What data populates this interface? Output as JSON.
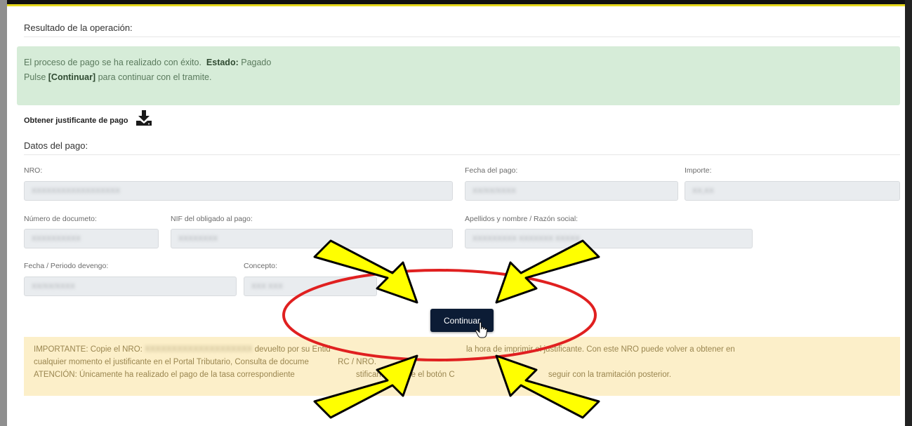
{
  "result": {
    "title": "Resultado de la operación:",
    "success_line1_text": "El proceso de pago se ha realizado con éxito.",
    "estado_label": "Estado:",
    "estado_value": "Pagado",
    "success_line2_pre": "Pulse ",
    "success_line2_button": "[Continuar]",
    "success_line2_post": " para continuar con el tramite."
  },
  "receipt": {
    "label": "Obtener justificante de pago",
    "icon": "download-icon"
  },
  "payment": {
    "title": "Datos del pago:",
    "fields": {
      "nro": {
        "label": "NRO:",
        "value": "XXXXXXXXXXXXXXXXXX"
      },
      "fecha_pago": {
        "label": "Fecha del pago:",
        "value": "XX/XX/XXXX"
      },
      "importe": {
        "label": "Importe:",
        "value": "XX,XX"
      },
      "numero_documento": {
        "label": "Número de documeto:",
        "value": "XXXXXXXXXX"
      },
      "nif_obligado": {
        "label": "NIF del obligado al pago:",
        "value": "XXXXXXXX"
      },
      "apellidos_nombre": {
        "label": "Apellidos y nombre / Razón social:",
        "value": "XXXXXXXXX XXXXXXX XXXXX"
      },
      "fecha_periodo": {
        "label": "Fecha / Periodo devengo:",
        "value": "XX/XX/XXXX"
      },
      "concepto": {
        "label": "Concepto:",
        "value": "XXX XXX"
      }
    }
  },
  "actions": {
    "continue_label": "Continuar"
  },
  "important": {
    "line1_pre": "IMPORTANTE: Copie el NRO:",
    "line1_nro": "XXXXXXXXXXXXXXXXXXXX",
    "line1_mid": "devuelto por su Entid",
    "line1_end": "la hora de imprimir el justificante. Con este NRO puede volver a obtener en",
    "line2_pre": "cualquier momento el justificante en el Portal Tributario, Consulta de docume",
    "line2_end": "RC / NRO.",
    "line3_pre": "ATENCIÓN: Únicamente ha realizado el pago de la tasa correspondiente",
    "line3_mid": "stificante y pulse el botón C",
    "line3_end": "seguir con la tramitación posterior."
  },
  "annotation": {
    "ellipse_color": "#e02020",
    "arrow_fill": "#ffff00",
    "arrow_stroke": "#000000"
  }
}
